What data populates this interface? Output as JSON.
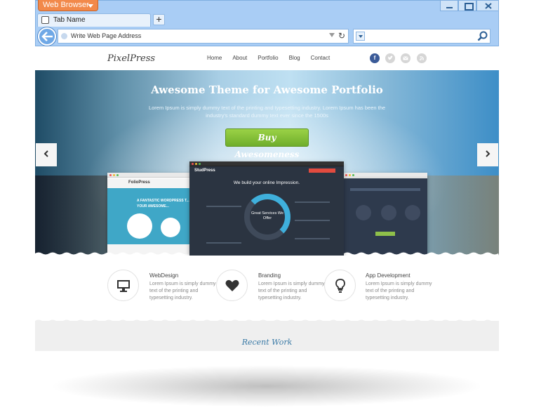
{
  "browser": {
    "app_menu_label": "Web Browser",
    "tab_label": "Tab Name",
    "new_tab_label": "+",
    "address_placeholder": "Write Web Page Address",
    "search_value": ""
  },
  "site": {
    "logo": "PixelPress",
    "nav": [
      "Home",
      "About",
      "Portfolio",
      "Blog",
      "Contact"
    ],
    "social": [
      "f",
      "",
      "",
      ""
    ]
  },
  "hero": {
    "title": "Awesome Theme for Awesome Portfolio",
    "subtitle": "Lorem Ipsum is simply dummy text of the printing and typesetting industry. Lorem Ipsum has been the industry's standard dummy text ever since the 1500s",
    "cta_label": "Buy Awesomeness",
    "prev_label": "‹",
    "next_label": "›",
    "left_shot": {
      "brand": "FolioPress",
      "tagline": "A FANTASTIC WORDPRESS T... YOUR AWESOME..."
    },
    "center_shot": {
      "brand": "StudPress",
      "headline": "We build your online Impression.",
      "donut_text": "Great Services We Offer"
    }
  },
  "features": [
    {
      "title": "WebDesign",
      "text": "Lorem Ipsum is simply dummy text of the printing and typesetting industry.",
      "icon": "monitor-icon"
    },
    {
      "title": "Branding",
      "text": "Lorem Ipsum is simply dummy text of the printing and typesetting industry.",
      "icon": "heart-icon"
    },
    {
      "title": "App Development",
      "text": "Lorem Ipsum is simply dummy text of the printing and typesetting industry.",
      "icon": "lightbulb-icon"
    }
  ],
  "recent": {
    "title": "Recent Work"
  },
  "colors": {
    "chrome": "#a9cdf5",
    "app_button": "#f2894a",
    "cta": "#7fbe35",
    "accent_blue": "#3a7aa6"
  }
}
